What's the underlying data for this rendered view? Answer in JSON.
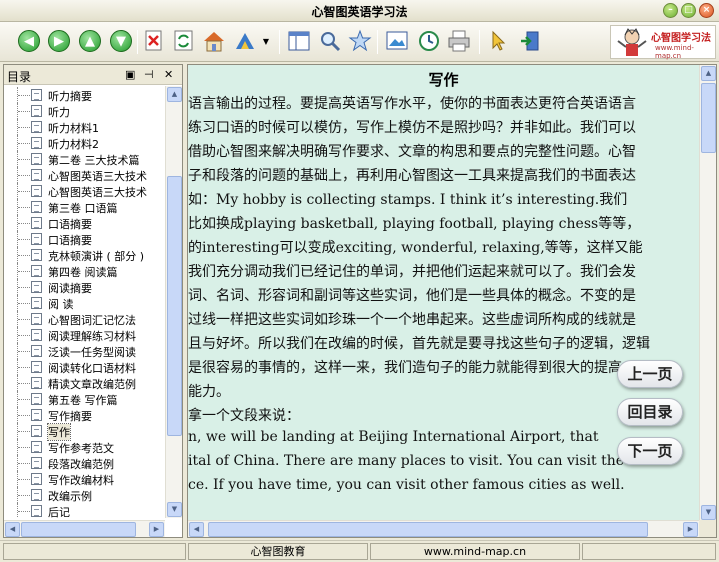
{
  "window": {
    "title": "心智图英语学习法",
    "controls": [
      "minimize",
      "maximize",
      "close"
    ]
  },
  "toolbar": {
    "buttons": [
      "back-icon",
      "forward-icon",
      "up-icon",
      "down-icon",
      "delete-icon",
      "refresh-icon",
      "home-icon",
      "tools-icon",
      "dropdown-icon",
      "layout-icon",
      "search-icon",
      "favorite-icon",
      "image-icon",
      "history-icon",
      "print-icon",
      "pointer-icon",
      "exit-icon"
    ],
    "logo": {
      "text": "心智图学习法",
      "url": "www.mind-map.cn"
    }
  },
  "sidebar": {
    "header": "目录",
    "items": [
      "听力摘要",
      "听力",
      "听力材料1",
      "听力材料2",
      "第二卷 三大技术篇",
      "心智图英语三大技术",
      "心智图英语三大技术",
      "第三卷 口语篇",
      "口语摘要",
      "口语摘要",
      "克林顿演讲 ( 部分 )",
      "第四卷 阅读篇",
      "阅读摘要",
      "阅 读",
      "心智图词汇记忆法",
      "阅读理解练习材料",
      "泛读一任务型阅读",
      "阅读转化口语材料",
      "精读文章改编范例",
      "第五卷 写作篇",
      "写作摘要",
      "写作",
      "写作参考范文",
      "段落改编范例",
      "写作改编材料",
      "改编示例",
      "后记"
    ],
    "selected_index": 21
  },
  "content": {
    "title": "写作",
    "lines": [
      "语言输出的过程。要提高英语写作水平，使你的书面表达更符合英语语言",
      "练习口语的时候可以模仿，写作上模仿不是照抄吗？并非如此。我们可以",
      "借助心智图来解决明确写作要求、文章的构思和要点的完整性问题。心智",
      "子和段落的问题的基础上，再利用心智图这一工具来提高我们的书面表达",
      "如：My hobby is collecting stamps. I think it’s interesting.我们",
      "比如换成playing basketball, playing football, playing chess等等，",
      "的interesting可以变成exciting, wonderful, relaxing,等等，这样又能",
      "我们充分调动我们已经记住的单词，并把他们运起来就可以了。我们会发",
      "词、名词、形容词和副词等这些实词，他们是一些具体的概念。不变的是",
      "过线一样把这些实词如珍珠一个一个地串起来。这些虚词所构成的线就是",
      "且与好坏。所以我们在改编的时候，首先就是要寻找这些句子的逻辑，逻辑",
      "是很容易的事情的，这样一来，我们造句子的能力就能得到很大的提高。",
      "能力。",
      "  拿一个文段来说：",
      "n, we will be landing at Beijing International Airport, that",
      "ital of China. There are many places to visit. You can visit the",
      "ce. If you have time, you can visit other famous cities as well."
    ]
  },
  "nav": {
    "prev": "上一页",
    "toc": "回目录",
    "next": "下一页"
  },
  "statusbar": {
    "company": "心智图教育",
    "url": "www.mind-map.cn"
  }
}
